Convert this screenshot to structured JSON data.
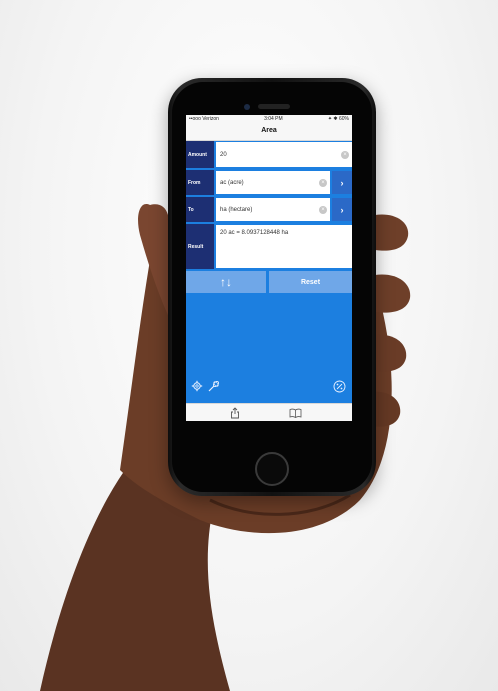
{
  "status": {
    "carrier": "••ooo Verizon",
    "time": "3:04 PM",
    "battery": "✦ ✱ 60%"
  },
  "nav": {
    "title": "Area"
  },
  "form": {
    "amount_label": "Amount",
    "amount_value": "20",
    "from_label": "From",
    "from_value": "ac (acre)",
    "to_label": "To",
    "to_value": "ha (hectare)",
    "result_label": "Result",
    "result_value": "20 ac = 8.0937128448 ha"
  },
  "buttons": {
    "swap_label": "↑↓",
    "reset_label": "Reset"
  },
  "icons": {
    "clear": "clear-icon",
    "chevron": "chevron-right-icon",
    "settings": "gear-icon",
    "cooking": "whisk-icon",
    "percent": "percent-icon",
    "share": "share-icon",
    "book": "book-icon"
  },
  "colors": {
    "accent": "#1c7fe0",
    "label_bg": "#1d2f73",
    "button": "#6fa7e8"
  }
}
